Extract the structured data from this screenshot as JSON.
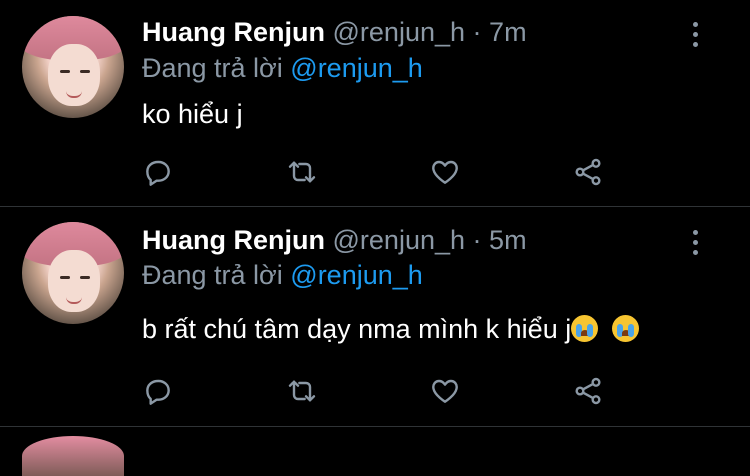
{
  "tweets": [
    {
      "name": "Huang Renjun",
      "handle": "@renjun_h",
      "separator": "·",
      "time": "7m",
      "reply_prefix": "Đang trả lời",
      "reply_mention": "@renjun_h",
      "text": "ko hiểu j",
      "emojis": []
    },
    {
      "name": "Huang Renjun",
      "handle": "@renjun_h",
      "separator": "·",
      "time": "5m",
      "reply_prefix": "Đang trả lời",
      "reply_mention": "@renjun_h",
      "text": "b rất chú tâm dạy nma mình k hiểu j",
      "emojis": [
        "loudly-crying-face",
        "loudly-crying-face"
      ]
    }
  ],
  "icons": {
    "reply": "comment-icon",
    "retweet": "retweet-icon",
    "like": "heart-icon",
    "share": "share-icon",
    "more": "more-vertical-icon"
  },
  "colors": {
    "background": "#000000",
    "secondary_text": "#8b98a5",
    "mention": "#1d9bf0",
    "divider": "#2f3336"
  }
}
